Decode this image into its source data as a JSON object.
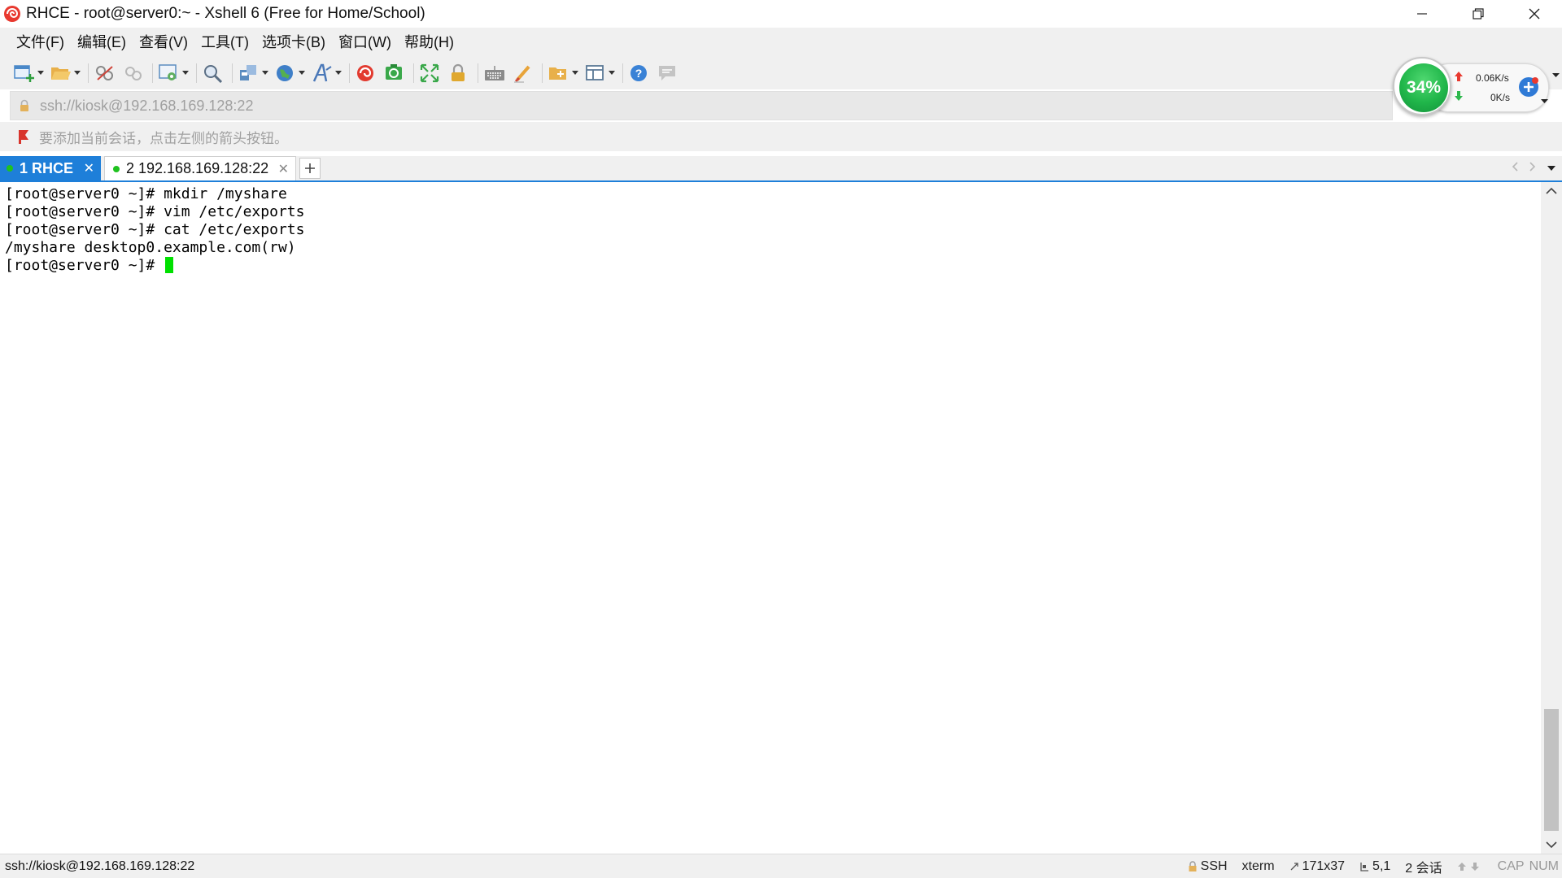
{
  "window": {
    "title": "RHCE - root@server0:~ - Xshell 6 (Free for Home/School)"
  },
  "menu": {
    "items": [
      "文件(F)",
      "编辑(E)",
      "查看(V)",
      "工具(T)",
      "选项卡(B)",
      "窗口(W)",
      "帮助(H)"
    ]
  },
  "toolbar": {
    "icons": [
      "new-session-icon",
      "open-folder-icon",
      "reconnect-icon",
      "disconnect-icon",
      "properties-icon",
      "find-icon",
      "transfer-icon",
      "globe-icon",
      "font-icon",
      "xftp-icon",
      "xmanager-icon",
      "fullscreen-icon",
      "lock-icon",
      "keyboard-icon",
      "highlight-icon",
      "new-folder-icon",
      "layout-icon",
      "help-icon",
      "chat-icon"
    ]
  },
  "address": {
    "value": "ssh://kiosk@192.168.169.128:22"
  },
  "hint": {
    "text": "要添加当前会话，点击左侧的箭头按钮。"
  },
  "monitor": {
    "cpu": "34%",
    "upload": "0.06K/s",
    "download": "0K/s",
    "colors": {
      "cpu": "#20b64a",
      "up_arrow": "#e8392f",
      "down_arrow": "#2eb84d"
    }
  },
  "tabs": [
    {
      "label": "1 RHCE",
      "active": true
    },
    {
      "label": "2 192.168.169.128:22",
      "active": false
    }
  ],
  "terminal": {
    "lines": [
      "[root@server0 ~]# mkdir /myshare",
      "[root@server0 ~]# vim /etc/exports",
      "[root@server0 ~]# cat /etc/exports",
      "/myshare desktop0.example.com(rw)",
      "[root@server0 ~]# "
    ],
    "cursor_color": "#00e000"
  },
  "status": {
    "connection": "ssh://kiosk@192.168.169.128:22",
    "protocol": "SSH",
    "terminal_type": "xterm",
    "size": "171x37",
    "cursor_pos": "5,1",
    "sessions": "2 会话",
    "cap": "CAP",
    "num": "NUM"
  },
  "theme": {
    "accent": "#1e7fd9",
    "session_dot": "#1fc21f"
  }
}
